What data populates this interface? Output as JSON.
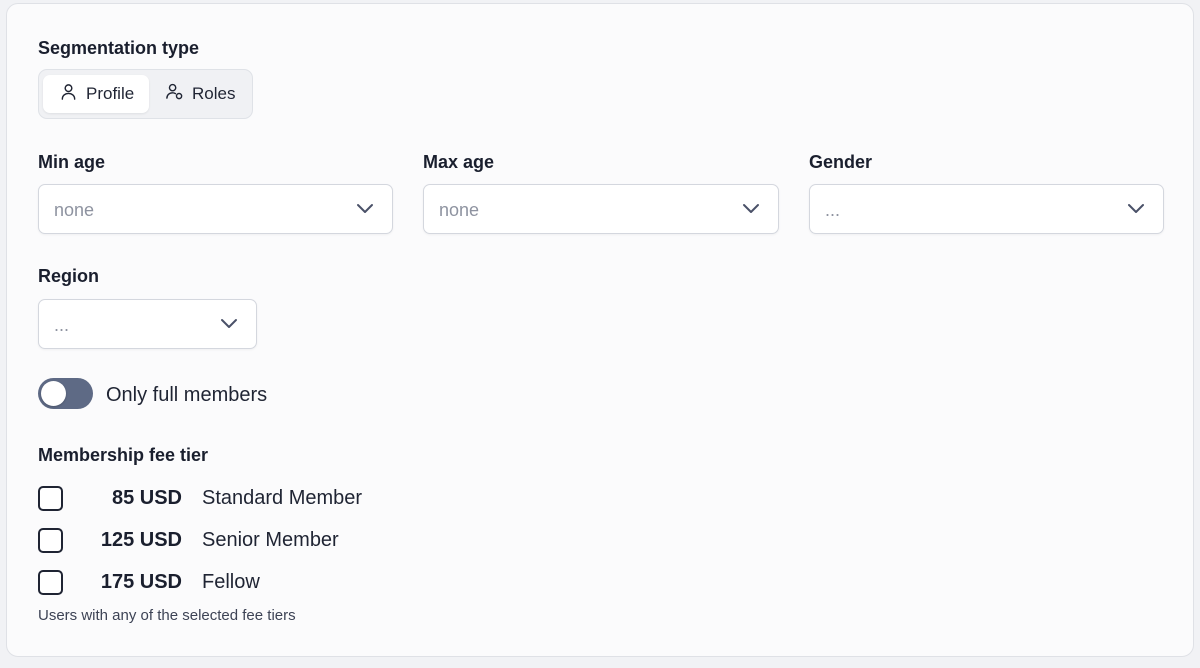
{
  "segmentation": {
    "label": "Segmentation type",
    "options": [
      {
        "label": "Profile",
        "icon": "user-icon",
        "active": true
      },
      {
        "label": "Roles",
        "icon": "user-role-icon",
        "active": false
      }
    ]
  },
  "filters": {
    "min_age": {
      "label": "Min age",
      "value": "none"
    },
    "max_age": {
      "label": "Max age",
      "value": "none"
    },
    "gender": {
      "label": "Gender",
      "value": "..."
    },
    "region": {
      "label": "Region",
      "value": "..."
    }
  },
  "full_members": {
    "label": "Only full members",
    "enabled": false
  },
  "fee_tiers": {
    "label": "Membership fee tier",
    "items": [
      {
        "amount": "85 USD",
        "name": "Standard Member",
        "checked": false
      },
      {
        "amount": "125 USD",
        "name": "Senior Member",
        "checked": false
      },
      {
        "amount": "175 USD",
        "name": "Fellow",
        "checked": false
      }
    ],
    "helper": "Users with any of the selected fee tiers"
  },
  "colors": {
    "toggle_off": "#5e6a85",
    "text": "#1f2433",
    "placeholder": "#8e93a0"
  }
}
